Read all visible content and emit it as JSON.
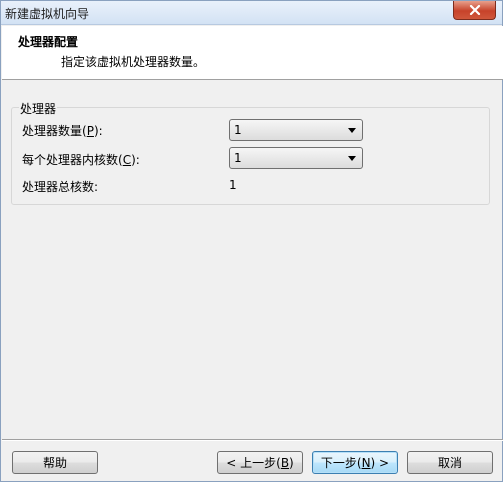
{
  "window": {
    "title": "新建虚拟机向导"
  },
  "header": {
    "title": "处理器配置",
    "subtitle": "指定该虚拟机处理器数量。"
  },
  "processor_group": {
    "title": "处理器",
    "processor_count": {
      "label_prefix": "处理器数量(",
      "accelerator": "P",
      "label_suffix": "):",
      "value": "1"
    },
    "cores_per_processor": {
      "label_prefix": "每个处理器内核数(",
      "accelerator": "C",
      "label_suffix": "):",
      "value": "1"
    },
    "total_cores": {
      "label": "处理器总核数:",
      "value": "1"
    }
  },
  "footer": {
    "help_label": "帮助",
    "back": {
      "label_prefix": "< 上一步(",
      "accelerator": "B",
      "label_suffix": ")"
    },
    "next": {
      "label_prefix": "下一步(",
      "accelerator": "N",
      "label_suffix": ") >"
    },
    "cancel_label": "取消"
  },
  "icons": {
    "close": "close-icon",
    "dropdown": "chevron-down-icon"
  },
  "colors": {
    "close_button": "#c7432a",
    "header_background": "#ffffff",
    "dialog_background": "#f0f0f0",
    "default_button_border": "#3c7fb1"
  }
}
